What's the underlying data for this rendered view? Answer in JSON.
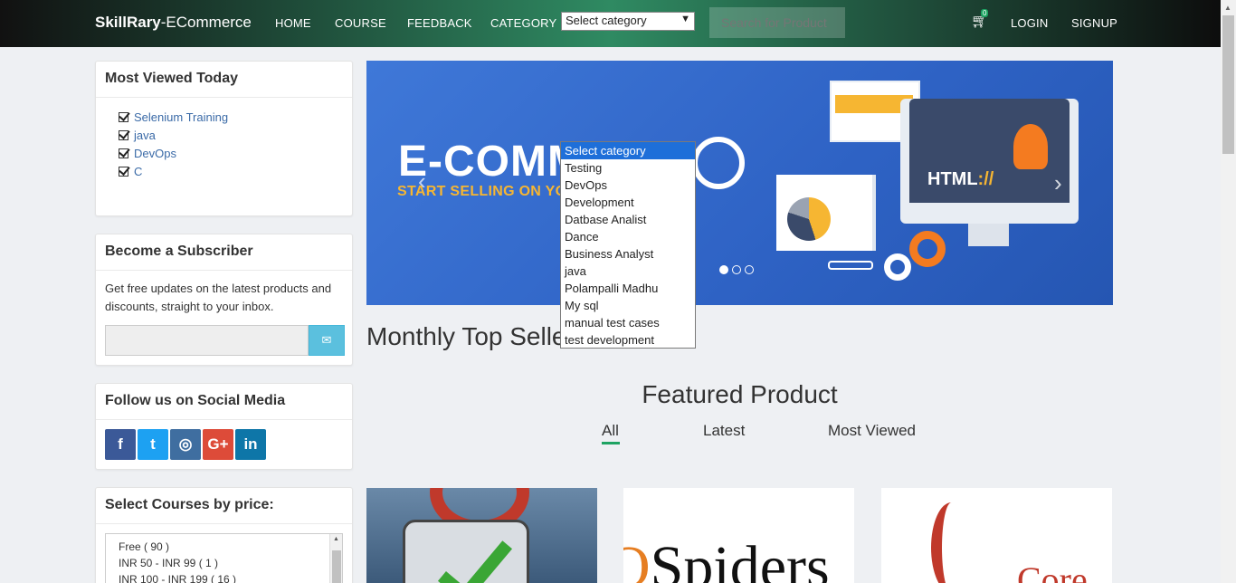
{
  "navbar": {
    "brand_bold": "SkillRary",
    "brand_rest": "-ECommerce",
    "links": [
      "HOME",
      "COURSE",
      "FEEDBACK",
      "CATEGORY"
    ],
    "category_select_value": "Select category",
    "search_placeholder": "Search for Product",
    "cart_count": "0",
    "login": "LOGIN",
    "signup": "SIGNUP"
  },
  "sidebar": {
    "most_viewed": {
      "title": "Most Viewed Today",
      "items": [
        "Selenium Training",
        "java",
        "DevOps",
        "C"
      ]
    },
    "subscriber": {
      "title": "Become a Subscriber",
      "text": "Get free updates on the latest products and discounts, straight to your inbox."
    },
    "social": {
      "title": "Follow us on Social Media",
      "icons": [
        "facebook-icon",
        "twitter-icon",
        "instagram-icon",
        "google-plus-icon",
        "linkedin-icon"
      ],
      "colors": [
        "#3b5998",
        "#1da1f2",
        "#3f6ea0",
        "#dd4b39",
        "#0e76a8"
      ]
    },
    "price": {
      "title": "Select Courses by price:",
      "options": [
        "Free ( 90 )",
        "INR 50 - INR 99 ( 1 )",
        "INR 100 - INR 199 ( 16 )"
      ]
    }
  },
  "banner": {
    "title": "E-COMM",
    "subtitle": "START SELLING ON YO",
    "html_label": "HTML",
    "html_suffix": "://",
    "active_slide": 1,
    "slide_count": 3
  },
  "category_dropdown": {
    "options": [
      "Select category",
      "Testing",
      "DevOps",
      "Development",
      "Datbase Analist",
      "Dance",
      "Business Analyst",
      "java",
      "Polampalli Madhu",
      "My sql",
      "manual test cases",
      "test development"
    ],
    "selected_index": 0
  },
  "main": {
    "monthly_title": "Monthly Top Selle",
    "featured_title": "Featured Product",
    "tabs": [
      "All",
      "Latest",
      "Most Viewed"
    ],
    "active_tab": "All"
  },
  "cards": {
    "card2_logo_q": "Q",
    "card2_logo_rest": "Spiders",
    "card3_text": "Core"
  },
  "colors": {
    "accent_green": "#1ea362",
    "banner_blue": "#3f78d8",
    "link_blue": "#3a6aa7",
    "banner_orange": "#f6b632"
  }
}
